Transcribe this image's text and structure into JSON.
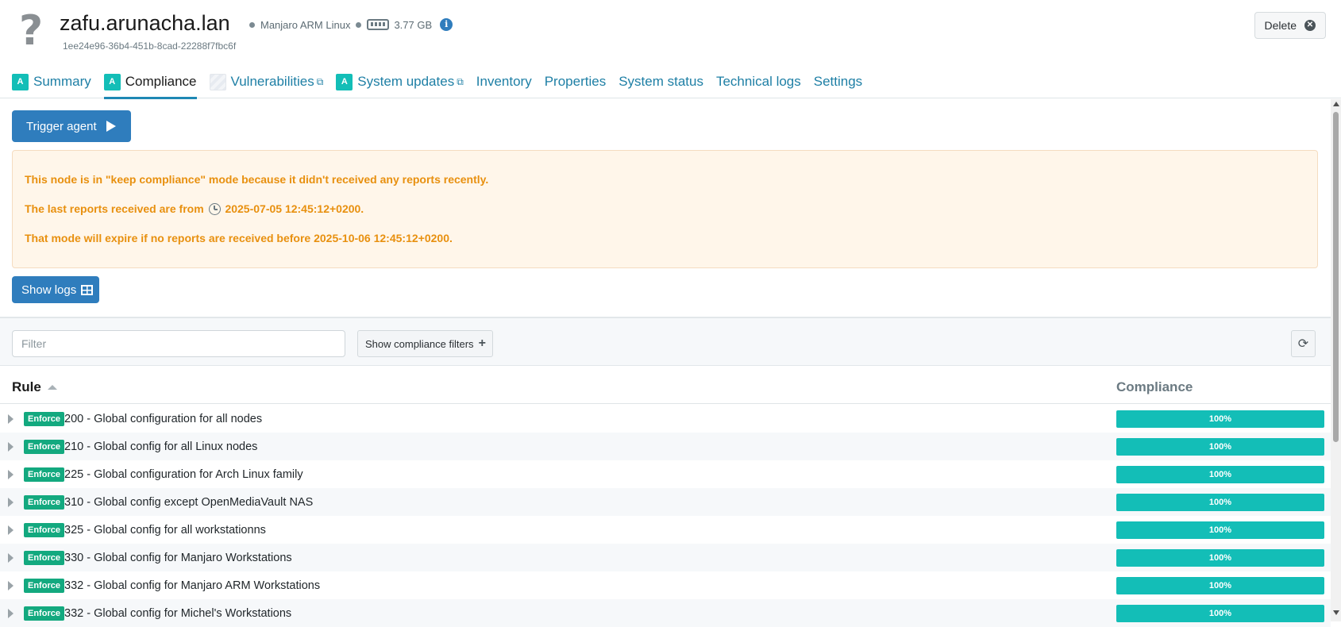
{
  "node": {
    "hostname": "zafu.arunacha.lan",
    "os": "Manjaro ARM Linux",
    "ram": "3.77 GB",
    "id": "1ee24e96-36b4-451b-8cad-22288f7fbc6f",
    "icon": "?",
    "delete_label": "Delete"
  },
  "tabs": [
    {
      "label": "Summary",
      "badge": "A"
    },
    {
      "label": "Compliance",
      "badge": "A"
    },
    {
      "label": "Vulnerabilities",
      "badge": ""
    },
    {
      "label": "System updates",
      "badge": "A"
    },
    {
      "label": "Inventory"
    },
    {
      "label": "Properties"
    },
    {
      "label": "System status"
    },
    {
      "label": "Technical logs"
    },
    {
      "label": "Settings"
    }
  ],
  "actions": {
    "trigger_label": "Trigger agent",
    "show_logs_label": "Show logs"
  },
  "alert": {
    "line1": "This node is in \"keep compliance\" mode because it didn't received any reports recently.",
    "line2_prefix": "The last reports received are from",
    "line2_date": "2025-07-05 12:45:12+0200.",
    "line3": "That mode will expire if no reports are received before 2025-10-06 12:45:12+0200."
  },
  "filters": {
    "filter_placeholder": "Filter",
    "compliance_filters_label": "Show compliance filters"
  },
  "table": {
    "col_rule": "Rule",
    "col_compliance": "Compliance",
    "rows": [
      {
        "mode": "Enforce",
        "name": "200 - Global configuration for all nodes",
        "compliance": "100%"
      },
      {
        "mode": "Enforce",
        "name": "210 - Global config for all Linux nodes",
        "compliance": "100%"
      },
      {
        "mode": "Enforce",
        "name": "225 - Global configuration for Arch Linux family",
        "compliance": "100%"
      },
      {
        "mode": "Enforce",
        "name": "310 - Global config except OpenMediaVault NAS",
        "compliance": "100%"
      },
      {
        "mode": "Enforce",
        "name": "325 - Global config for all workstationns",
        "compliance": "100%"
      },
      {
        "mode": "Enforce",
        "name": "330 - Global config for Manjaro Workstations",
        "compliance": "100%"
      },
      {
        "mode": "Enforce",
        "name": "332 - Global config for Manjaro ARM Workstations",
        "compliance": "100%"
      },
      {
        "mode": "Enforce",
        "name": "332 - Global config for Michel's Workstations",
        "compliance": "100%"
      }
    ]
  },
  "colors": {
    "accent": "#2f7dbd",
    "compliance_bar": "#13beb7",
    "enforce_badge": "#13a97f",
    "warning_text": "#e8900f"
  }
}
